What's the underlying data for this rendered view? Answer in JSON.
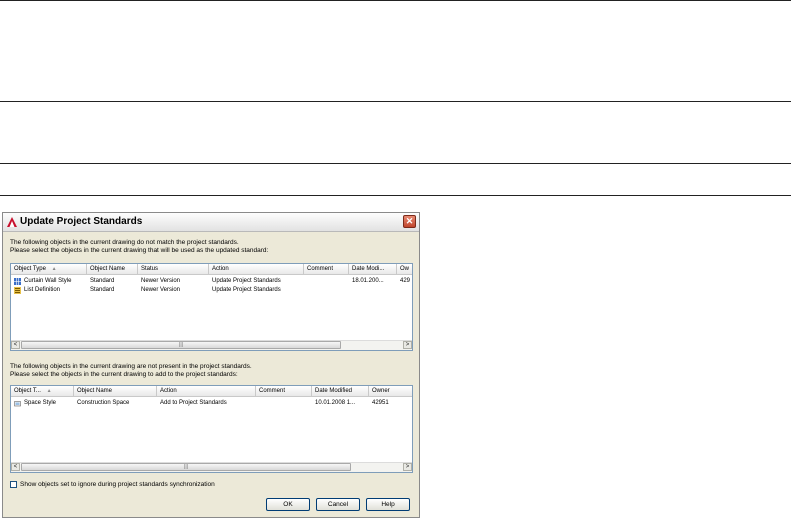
{
  "dialog": {
    "title": "Update Project Standards",
    "close_glyph": "✕",
    "intro_line1": "The following objects in the current drawing do not match the project standards.",
    "intro_line2": "Please select the objects in the current drawing that will be used as the updated standard:",
    "section2_line1": "The following objects in the current drawing are not present in the project standards.",
    "section2_line2": "Please select the objects in the current drawing to add to the project standards:",
    "checkbox_label": "Show objects set to ignore during project standards synchronization",
    "checkbox_checked": false,
    "ok_label": "OK",
    "cancel_label": "Cancel",
    "help_label": "Help"
  },
  "table1": {
    "headers": [
      "Object Type",
      "Object Name",
      "Status",
      "Action",
      "Comment",
      "Date Modi...",
      "Ow"
    ],
    "sort_column": "Object Type",
    "rows": [
      {
        "icon": "curtain-wall-style-icon",
        "cells": [
          "Curtain Wall Style",
          "Standard",
          "Newer Version",
          "Update Project Standards",
          "",
          "18.01.200...",
          "429"
        ]
      },
      {
        "icon": "list-definition-icon",
        "cells": [
          "List Definition",
          "Standard",
          "Newer Version",
          "Update Project Standards",
          "",
          "",
          ""
        ]
      }
    ]
  },
  "table2": {
    "headers": [
      "Object T...",
      "Object Name",
      "Action",
      "Comment",
      "Date Modified",
      "Owner"
    ],
    "sort_column": "Object T...",
    "rows": [
      {
        "icon": "space-style-icon",
        "cells": [
          "Space Style",
          "Construction Space",
          "Add to Project Standards",
          "",
          "10.01.2008 1...",
          "42951"
        ]
      }
    ]
  },
  "scroll": {
    "left_arrow": "<",
    "right_arrow": ">",
    "grip": "|||",
    "sort_arrow": "▲"
  },
  "colors": {
    "dialog_bg": "#ece9d8",
    "list_border": "#7f9db9",
    "button_border": "#003c74",
    "close_button": "#c0452c"
  }
}
